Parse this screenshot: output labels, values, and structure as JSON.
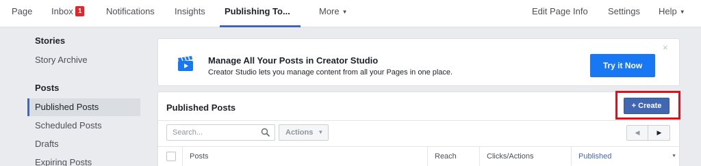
{
  "topnav": {
    "page": "Page",
    "inbox": "Inbox",
    "inbox_count": "1",
    "notifications": "Notifications",
    "insights": "Insights",
    "publishing_tools": "Publishing To...",
    "more": "More",
    "edit_page_info": "Edit Page Info",
    "settings": "Settings",
    "help": "Help"
  },
  "sidebar": {
    "stories_heading": "Stories",
    "story_archive": "Story Archive",
    "posts_heading": "Posts",
    "items": [
      "Published Posts",
      "Scheduled Posts",
      "Drafts",
      "Expiring Posts"
    ],
    "selected": "Published Posts"
  },
  "banner": {
    "title": "Manage All Your Posts in Creator Studio",
    "subtitle": "Creator Studio lets you manage content from all your Pages in one place.",
    "cta": "Try it Now",
    "close": "×"
  },
  "panel": {
    "title": "Published Posts",
    "create_label": "Create",
    "search_placeholder": "Search...",
    "actions_label": "Actions",
    "columns": [
      "Posts",
      "Reach",
      "Clicks/Actions",
      "Published"
    ],
    "sorted_column": "Published"
  },
  "colors": {
    "accent": "#4267b2",
    "cta": "#1877f2",
    "highlight": "#e0101a",
    "badge": "#e4252a"
  }
}
